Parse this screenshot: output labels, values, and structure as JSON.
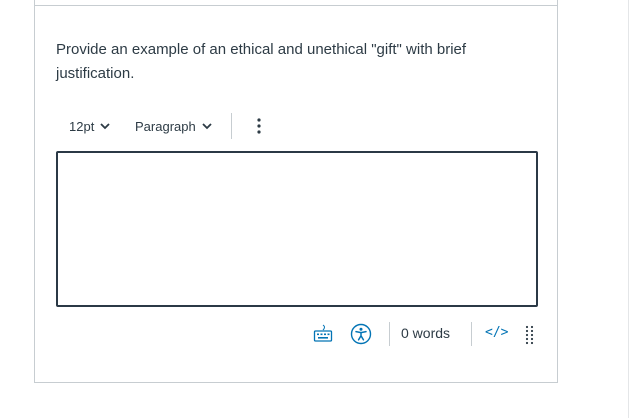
{
  "question": {
    "text": "Provide an example of an ethical and unethical \"gift\" with brief justification."
  },
  "toolbar": {
    "font_size": "12pt",
    "block_format": "Paragraph",
    "more_icon": "more-vertical-icon"
  },
  "editor": {
    "content": ""
  },
  "status_bar": {
    "keyboard_icon": "keyboard-icon",
    "accessibility_icon": "accessibility-icon",
    "word_count": "0 words",
    "html_toggle": "</>",
    "resize_icon": "drag-handle-icon"
  },
  "colors": {
    "text": "#2d3b45",
    "link": "#0374b5",
    "border": "#c7cdd1",
    "editor_border": "#2b3946"
  }
}
